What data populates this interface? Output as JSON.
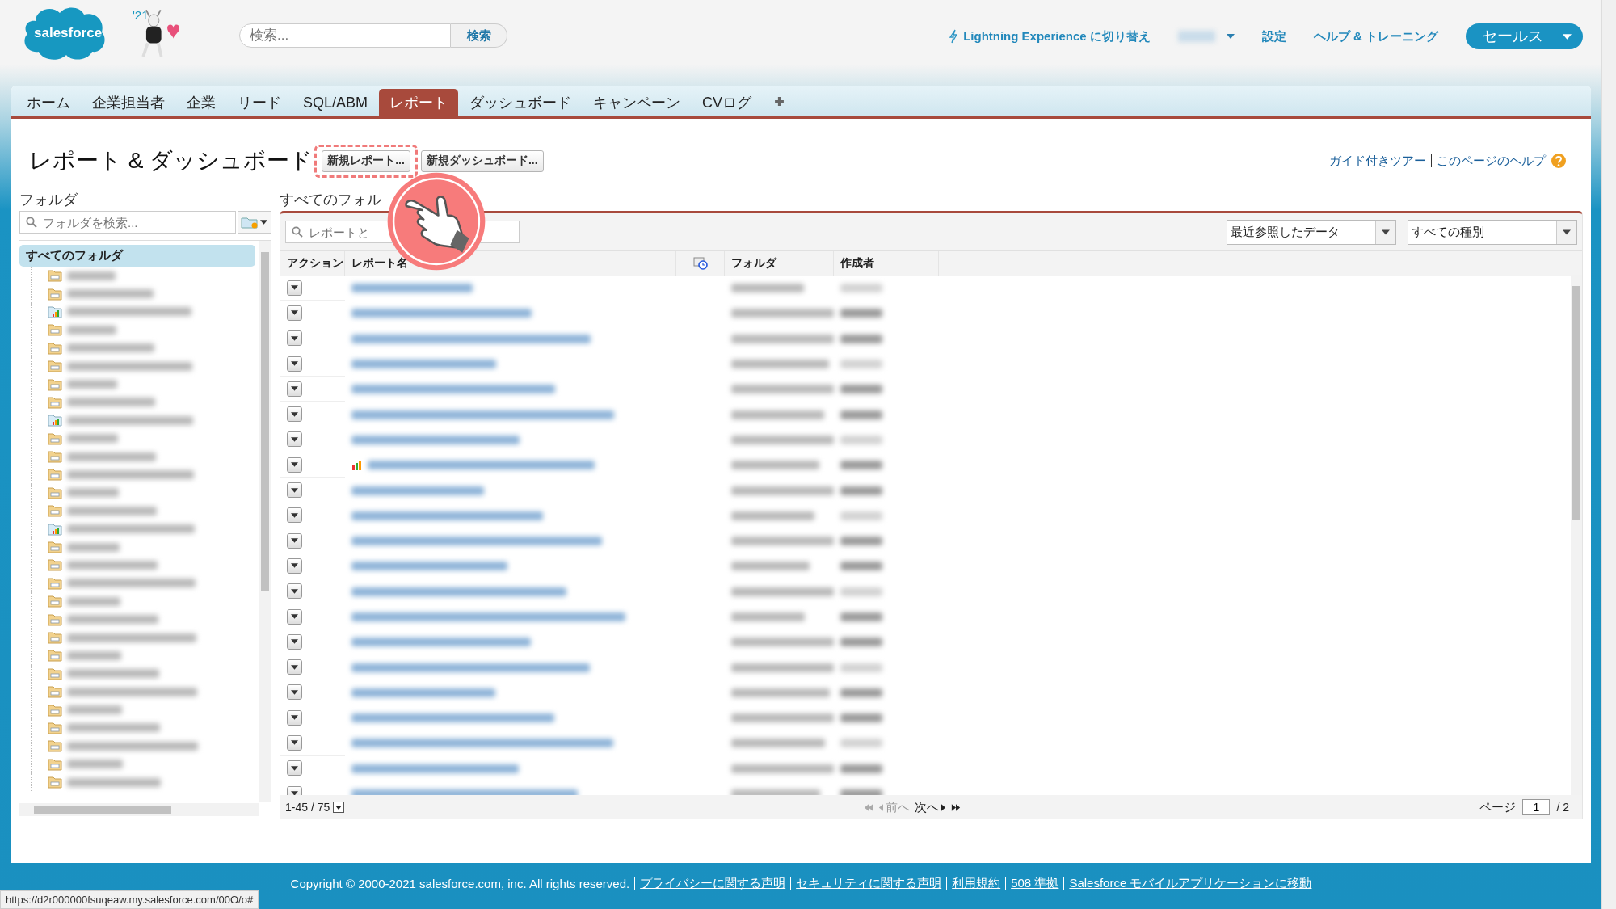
{
  "header": {
    "logo": "salesforce",
    "logo_year": "'21",
    "search": {
      "placeholder": "検索...",
      "button": "検索"
    },
    "links": [
      {
        "kind": "lightning",
        "label": "Lightning Experience に切り替え"
      },
      {
        "kind": "user-menu"
      },
      {
        "kind": "link",
        "label": "設定"
      },
      {
        "kind": "link",
        "label": "ヘルプ & トレーニング"
      }
    ],
    "app_menu": "セールス"
  },
  "tabs": [
    {
      "label": "ホーム",
      "selected": false
    },
    {
      "label": "企業担当者",
      "selected": false
    },
    {
      "label": "企業",
      "selected": false
    },
    {
      "label": "リード",
      "selected": false
    },
    {
      "label": "SQL/ABM",
      "selected": false
    },
    {
      "label": "レポート",
      "selected": true
    },
    {
      "label": "ダッシュボード",
      "selected": false
    },
    {
      "label": "キャンペーン",
      "selected": false
    },
    {
      "label": "CVログ",
      "selected": false
    }
  ],
  "page": {
    "title": "レポート & ダッシュボード",
    "buttons": [
      {
        "label": "新規レポート...",
        "highlighted": true
      },
      {
        "label": "新規ダッシュボード...",
        "highlighted": false
      }
    ],
    "help_links": [
      "ガイド付きツアー",
      "このページのヘルプ"
    ]
  },
  "folders": {
    "title": "フォルダ",
    "search_placeholder": "フォルダを検索...",
    "root": {
      "label": "すべてのフォルダ",
      "selected": true
    },
    "items": [
      {
        "kind": "table"
      },
      {
        "kind": "table"
      },
      {
        "kind": "chart"
      },
      {
        "kind": "table"
      },
      {
        "kind": "table"
      },
      {
        "kind": "table"
      },
      {
        "kind": "table"
      },
      {
        "kind": "table"
      },
      {
        "kind": "chart"
      },
      {
        "kind": "table"
      },
      {
        "kind": "table"
      },
      {
        "kind": "table"
      },
      {
        "kind": "table"
      },
      {
        "kind": "table"
      },
      {
        "kind": "chart"
      },
      {
        "kind": "table"
      },
      {
        "kind": "table"
      },
      {
        "kind": "table"
      },
      {
        "kind": "table"
      },
      {
        "kind": "table"
      },
      {
        "kind": "table"
      },
      {
        "kind": "table"
      },
      {
        "kind": "table"
      },
      {
        "kind": "table"
      },
      {
        "kind": "table"
      },
      {
        "kind": "table"
      },
      {
        "kind": "table"
      },
      {
        "kind": "table"
      },
      {
        "kind": "table"
      }
    ]
  },
  "reports": {
    "title": "すべてのフォル",
    "search_placeholder": "レポートと",
    "filters": [
      {
        "value": "最近参照したデータ"
      },
      {
        "value": "すべての種別"
      }
    ],
    "columns": [
      {
        "kind": "text",
        "label": "アクション"
      },
      {
        "kind": "text",
        "label": "レポート名"
      },
      {
        "kind": "icon"
      },
      {
        "kind": "text",
        "label": "フォルダ"
      },
      {
        "kind": "text",
        "label": "作成者"
      }
    ],
    "rows": [
      {
        "kind": "report"
      },
      {
        "kind": "report"
      },
      {
        "kind": "report"
      },
      {
        "kind": "report"
      },
      {
        "kind": "report"
      },
      {
        "kind": "report"
      },
      {
        "kind": "report"
      },
      {
        "kind": "chart"
      },
      {
        "kind": "report"
      },
      {
        "kind": "report"
      },
      {
        "kind": "report"
      },
      {
        "kind": "report"
      },
      {
        "kind": "report"
      },
      {
        "kind": "report"
      },
      {
        "kind": "report"
      },
      {
        "kind": "report"
      },
      {
        "kind": "report"
      },
      {
        "kind": "report"
      },
      {
        "kind": "report"
      },
      {
        "kind": "report"
      },
      {
        "kind": "report"
      }
    ],
    "pagination": {
      "range": "1-45 / 75",
      "prev": "前へ",
      "prev_disabled": true,
      "next": "次へ",
      "page_label": "ページ",
      "page": "1",
      "total": "/ 2"
    }
  },
  "footer": {
    "copyright": "Copyright © 2000-2021 salesforce.com, inc. All rights reserved.",
    "links": [
      "プライバシーに関する声明",
      "セキュリティに関する声明",
      "利用規約",
      "508 準拠",
      "Salesforce モバイルアプリケーションに移動"
    ]
  },
  "status_url": "https://d2r000000fsuqeaw.my.salesforce.com/00O/o#"
}
